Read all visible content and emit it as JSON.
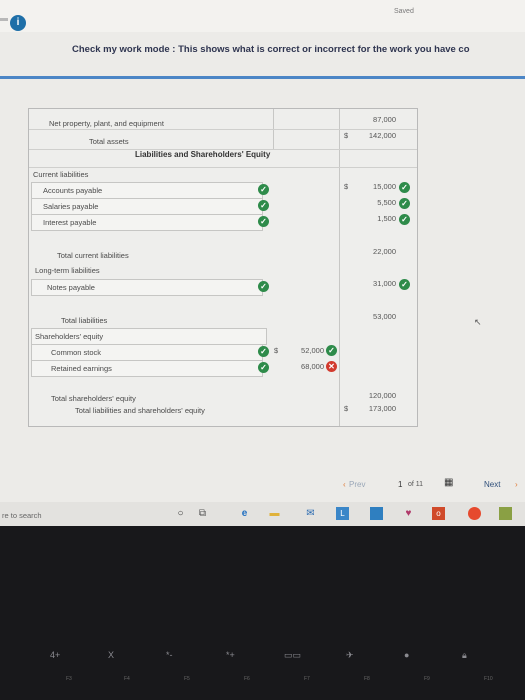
{
  "header": {
    "saved": "Saved",
    "info_glyph": "i"
  },
  "banner": {
    "text": "Check my work mode : This shows what is correct or incorrect for the work you have co"
  },
  "sheet": {
    "rows": {
      "ppe_label": "Net property, plant, and equipment",
      "ppe_value": "87,000",
      "total_assets_label": "Total assets",
      "total_assets_value": "142,000",
      "section_title": "Liabilities and Shareholders' Equity",
      "current_liabilities": "Current liabilities",
      "accounts_payable": "Accounts payable",
      "accounts_payable_value": "15,000",
      "salaries_payable": "Salaries payable",
      "salaries_payable_value": "5,500",
      "interest_payable": "Interest payable",
      "interest_payable_value": "1,500",
      "total_current_label": "Total current liabilities",
      "total_current_value": "22,000",
      "long_term": "Long-term liabilities",
      "notes_payable": "Notes payable",
      "notes_payable_value": "31,000",
      "total_liabilities_label": "Total liabilities",
      "total_liabilities_value": "53,000",
      "equity_header": "Shareholders' equity",
      "common_stock": "Common stock",
      "common_stock_value": "52,000",
      "retained_earnings": "Retained earnings",
      "retained_earnings_value": "68,000",
      "total_equity_label": "Total shareholders' equity",
      "total_equity_value": "120,000",
      "total_le_label": "Total liabilities and shareholders' equity",
      "total_le_value": "173,000"
    },
    "dollar": "$",
    "check_glyph": "✓",
    "wrong_glyph": "✕"
  },
  "pager": {
    "prev": "Prev",
    "current": "1",
    "of": "of 11",
    "next": "Next"
  },
  "taskbar": {
    "search": "re to search"
  },
  "keyboard": {
    "keys": [
      "4+",
      "X",
      "*-",
      "*+",
      "",
      "",
      "",
      ""
    ],
    "subs": [
      "F3",
      "F4",
      "F5",
      "F6",
      "F7",
      "F8",
      "F9",
      "F10"
    ]
  },
  "colors": {
    "accent": "#4c86c6",
    "correct": "#2e8b4a",
    "incorrect": "#d23a2e"
  }
}
